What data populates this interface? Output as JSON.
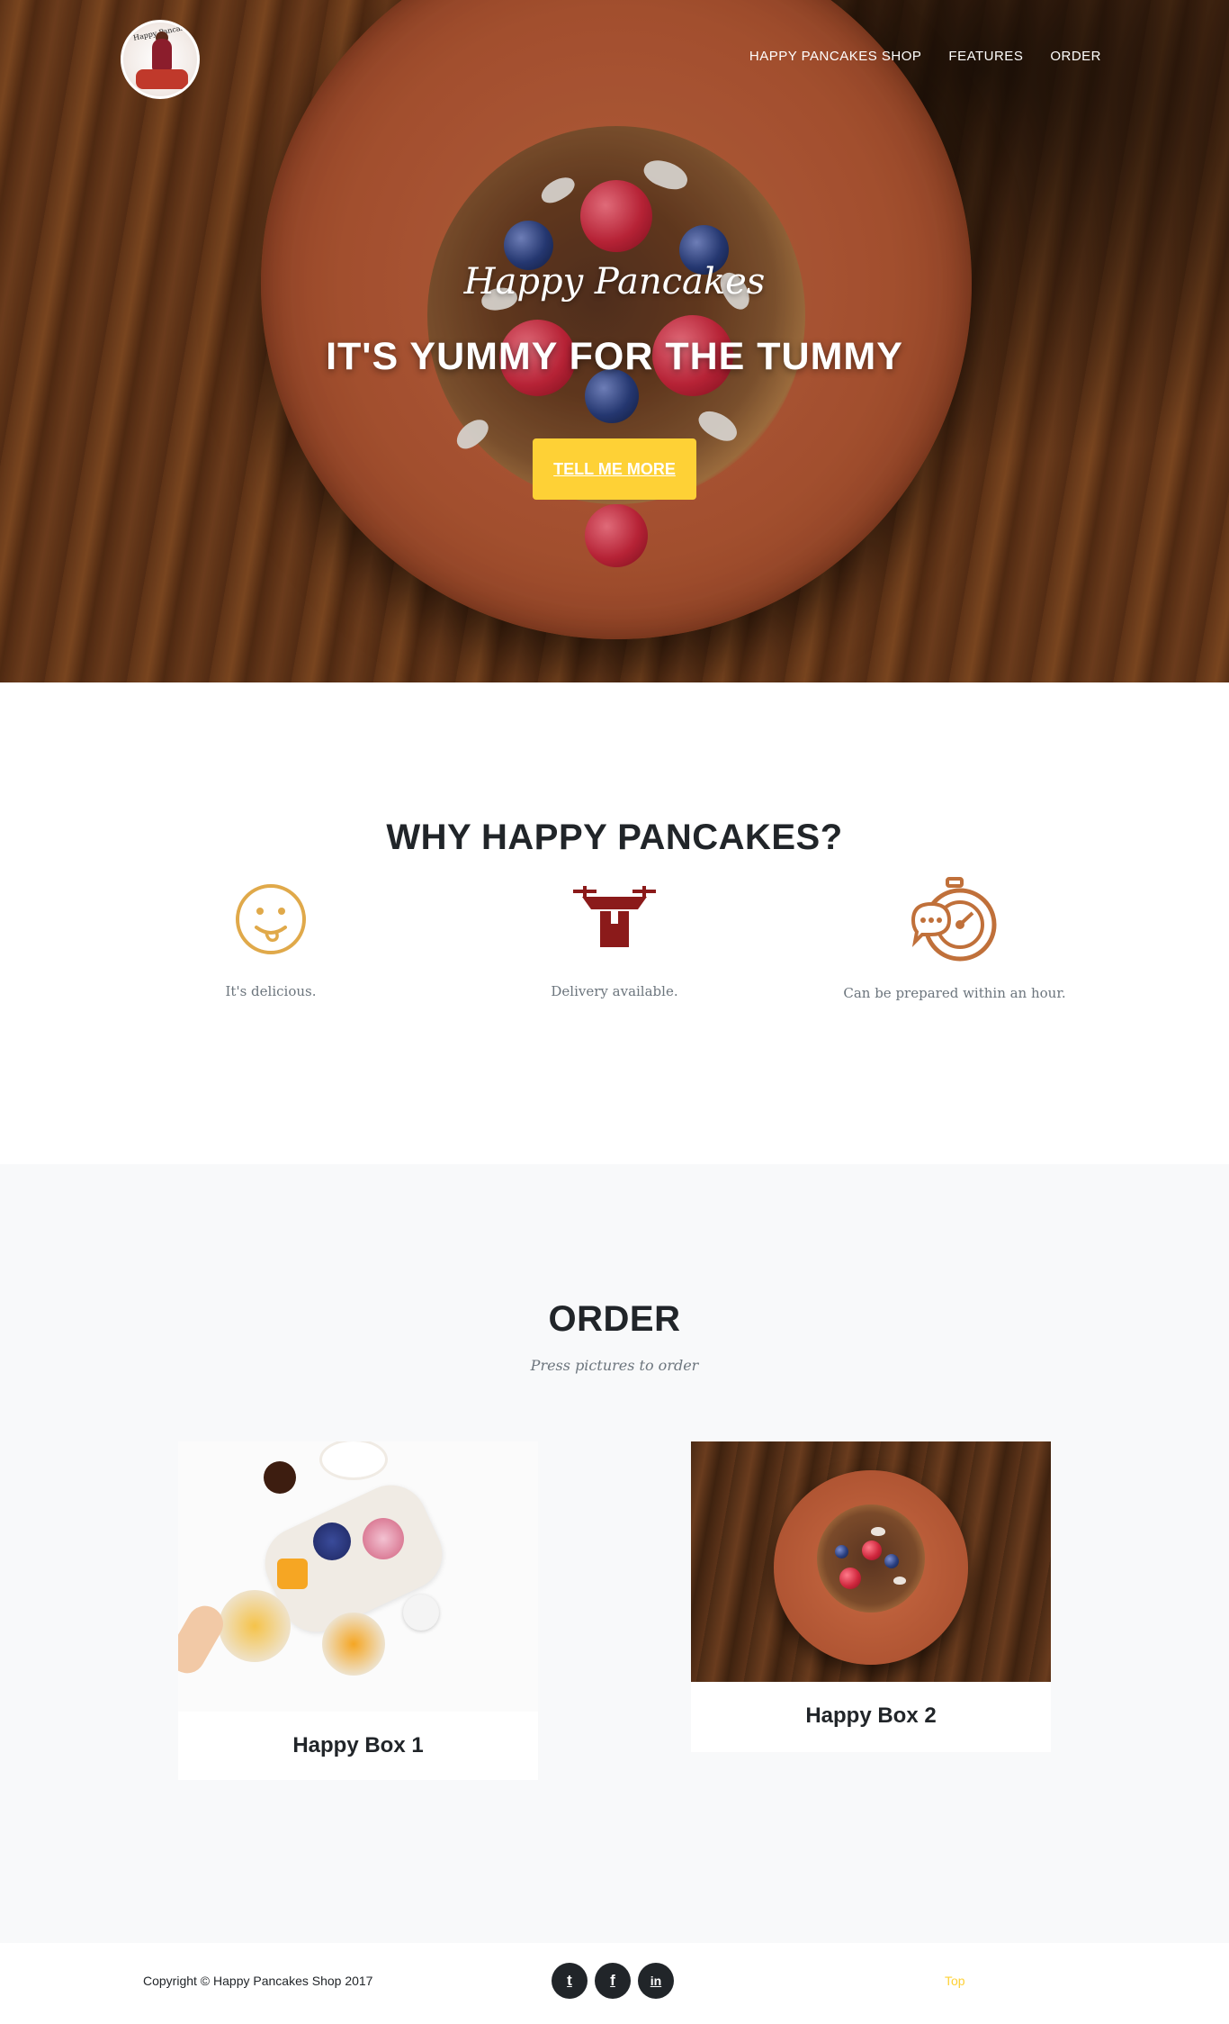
{
  "nav": {
    "logo_text": "Happy Pancakes",
    "items": [
      {
        "label": "HAPPY PANCAKES SHOP"
      },
      {
        "label": "FEATURES"
      },
      {
        "label": "ORDER"
      }
    ]
  },
  "hero": {
    "lead_in": "Happy Pancakes",
    "heading": "IT'S YUMMY FOR THE TUMMY",
    "cta_label": "TELL ME MORE"
  },
  "features": {
    "title": "WHY HAPPY PANCAKES?",
    "items": [
      {
        "icon": "smiley-tongue-icon",
        "text": "It's delicious.",
        "color": "#e0a94a"
      },
      {
        "icon": "delivery-drone-icon",
        "text": "Delivery available.",
        "color": "#8b1a1a"
      },
      {
        "icon": "stopwatch-chat-icon",
        "text": "Can be prepared within an hour.",
        "color": "#c0703a"
      }
    ]
  },
  "order": {
    "title": "ORDER",
    "subtitle": "Press pictures to order",
    "items": [
      {
        "name": "Happy Box 1"
      },
      {
        "name": "Happy Box 2"
      }
    ]
  },
  "footer": {
    "copyright": "Copyright © Happy Pancakes Shop 2017",
    "socials": [
      {
        "icon": "twitter-icon",
        "glyph": "t"
      },
      {
        "icon": "facebook-icon",
        "glyph": "f"
      },
      {
        "icon": "linkedin-icon",
        "glyph": "in"
      }
    ],
    "top_link": "Top"
  },
  "colors": {
    "accent": "#fed136",
    "dark": "#212529",
    "muted": "#6c757d",
    "section_bg": "#f8f9fa"
  }
}
